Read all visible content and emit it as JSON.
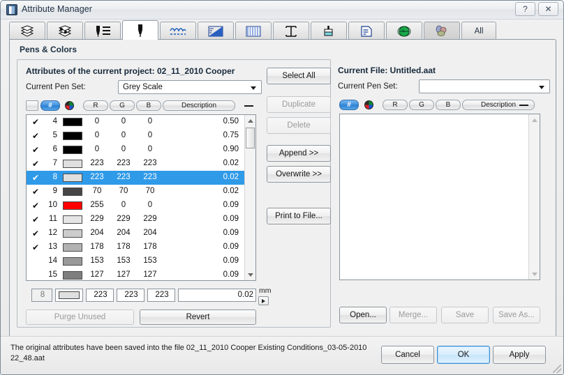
{
  "window": {
    "title": "Attribute Manager",
    "help_label": "?",
    "close_label": "✕"
  },
  "tabs": [
    {
      "id": "layers",
      "icon": "layers-icon",
      "label": "",
      "selected": false
    },
    {
      "id": "classes",
      "icon": "classes-icon",
      "label": "",
      "selected": false
    },
    {
      "id": "pen-list",
      "icon": "pen-list-icon",
      "label": "",
      "selected": false
    },
    {
      "id": "pens",
      "icon": "pen-icon",
      "label": "",
      "selected": true
    },
    {
      "id": "linetypes",
      "icon": "linetype-icon",
      "label": "",
      "selected": false
    },
    {
      "id": "fills",
      "icon": "fill-icon",
      "label": "",
      "selected": false
    },
    {
      "id": "hatches",
      "icon": "hatch-icon",
      "label": "",
      "selected": false
    },
    {
      "id": "sections",
      "icon": "ibeam-icon",
      "label": "",
      "selected": false
    },
    {
      "id": "brushes",
      "icon": "brush-icon",
      "label": "",
      "selected": false
    },
    {
      "id": "textstyles",
      "icon": "textstyle-icon",
      "label": "",
      "selected": false
    },
    {
      "id": "globe",
      "icon": "globe-icon",
      "label": "",
      "selected": false
    },
    {
      "id": "materials",
      "icon": "materials-icon",
      "label": "",
      "selected": false
    },
    {
      "id": "all",
      "icon": "",
      "label": "All",
      "selected": false
    }
  ],
  "section": {
    "title": "Pens & Colors"
  },
  "left_panel": {
    "heading": "Attributes of the current project: 02_11_2010 Cooper",
    "pen_set_label": "Current Pen Set:",
    "pen_set_value": "Grey Scale",
    "columns": {
      "check": "",
      "number": "#",
      "color": "color-wheel-icon",
      "r": "R",
      "g": "G",
      "b": "B",
      "description": "Description",
      "width": "—"
    },
    "rows": [
      {
        "checked": true,
        "num": "4",
        "swatch": "#000000",
        "r": "0",
        "g": "0",
        "b": "0",
        "desc": "",
        "width": "0.50",
        "selected": false
      },
      {
        "checked": true,
        "num": "5",
        "swatch": "#000000",
        "r": "0",
        "g": "0",
        "b": "0",
        "desc": "",
        "width": "0.75",
        "selected": false
      },
      {
        "checked": true,
        "num": "6",
        "swatch": "#000000",
        "r": "0",
        "g": "0",
        "b": "0",
        "desc": "",
        "width": "0.90",
        "selected": false
      },
      {
        "checked": true,
        "num": "7",
        "swatch": "#dfdfdf",
        "r": "223",
        "g": "223",
        "b": "223",
        "desc": "",
        "width": "0.02",
        "selected": false
      },
      {
        "checked": true,
        "num": "8",
        "swatch": "#dfdfdf",
        "r": "223",
        "g": "223",
        "b": "223",
        "desc": "",
        "width": "0.02",
        "selected": true
      },
      {
        "checked": true,
        "num": "9",
        "swatch": "#464646",
        "r": "70",
        "g": "70",
        "b": "70",
        "desc": "",
        "width": "0.02",
        "selected": false
      },
      {
        "checked": true,
        "num": "10",
        "swatch": "#ff0000",
        "r": "255",
        "g": "0",
        "b": "0",
        "desc": "",
        "width": "0.09",
        "selected": false
      },
      {
        "checked": true,
        "num": "11",
        "swatch": "#e5e5e5",
        "r": "229",
        "g": "229",
        "b": "229",
        "desc": "",
        "width": "0.09",
        "selected": false
      },
      {
        "checked": true,
        "num": "12",
        "swatch": "#cccccc",
        "r": "204",
        "g": "204",
        "b": "204",
        "desc": "",
        "width": "0.09",
        "selected": false
      },
      {
        "checked": true,
        "num": "13",
        "swatch": "#b2b2b2",
        "r": "178",
        "g": "178",
        "b": "178",
        "desc": "",
        "width": "0.09",
        "selected": false
      },
      {
        "checked": false,
        "num": "14",
        "swatch": "#999999",
        "r": "153",
        "g": "153",
        "b": "153",
        "desc": "",
        "width": "0.09",
        "selected": false
      },
      {
        "checked": false,
        "num": "15",
        "swatch": "#7f7f7f",
        "r": "127",
        "g": "127",
        "b": "127",
        "desc": "",
        "width": "0.09",
        "selected": false
      }
    ],
    "edit_row": {
      "num": "8",
      "swatch": "#dfdfdf",
      "r": "223",
      "g": "223",
      "b": "223",
      "desc": "",
      "width": "0.02",
      "units": "mm"
    },
    "purge_label": "Purge Unused",
    "revert_label": "Revert"
  },
  "middle_buttons": [
    {
      "id": "select-all",
      "label": "Select All",
      "enabled": true
    },
    {
      "id": "duplicate",
      "label": "Duplicate",
      "enabled": false
    },
    {
      "id": "delete",
      "label": "Delete",
      "enabled": false
    },
    {
      "id": "append",
      "label": "Append >>",
      "enabled": true
    },
    {
      "id": "overwrite",
      "label": "Overwrite >>",
      "enabled": true
    },
    {
      "id": "print-file",
      "label": "Print to File...",
      "enabled": true
    }
  ],
  "right_panel": {
    "heading": "Current File: Untitled.aat",
    "pen_set_label": "Current Pen Set:",
    "pen_set_value": "",
    "columns": {
      "number": "#",
      "color": "color-wheel-icon",
      "r": "R",
      "g": "G",
      "b": "B",
      "description": "Description",
      "width": "—"
    },
    "rows": [],
    "buttons": [
      {
        "id": "open",
        "label": "Open...",
        "enabled": true
      },
      {
        "id": "merge",
        "label": "Merge...",
        "enabled": false
      },
      {
        "id": "save",
        "label": "Save",
        "enabled": false
      },
      {
        "id": "save-as",
        "label": "Save As...",
        "enabled": false
      }
    ]
  },
  "footer": {
    "status": "The original attributes have been saved into the file 02_11_2010 Cooper Existing Conditions_03-05-2010 22_48.aat",
    "cancel_label": "Cancel",
    "ok_label": "OK",
    "apply_label": "Apply"
  },
  "colors": {
    "selection_blue": "#2f9ae8",
    "default_button_blue": "#3c8fd4",
    "title_text": "#1d3043"
  }
}
